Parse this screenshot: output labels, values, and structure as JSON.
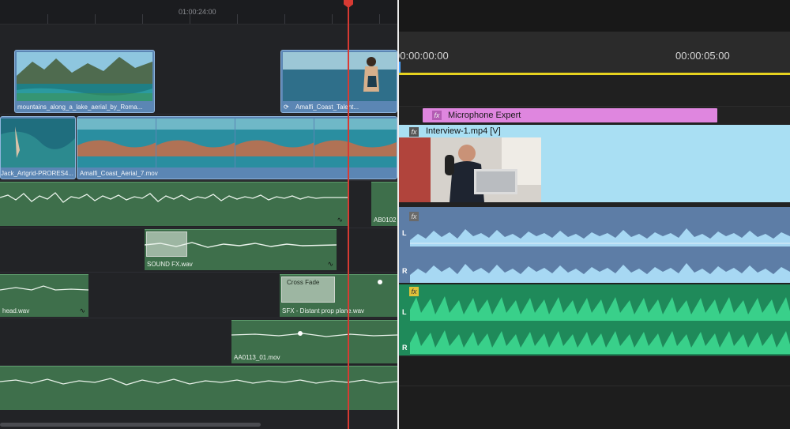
{
  "left_timeline": {
    "ruler_timecode": "01:00:24:00",
    "video_clips": [
      {
        "label": "mountains_along_a_lake_aerial_by_Roma..."
      },
      {
        "label": "Amalfi_Coast_Talent..."
      },
      {
        "label": "Jack_Artgrid-PRORES4..."
      },
      {
        "label": "Amalfi_Coast_Aerial_7.mov"
      }
    ],
    "audio_clips": [
      {
        "label": ""
      },
      {
        "label": "AB0102"
      },
      {
        "label": "SOUND FX.wav"
      },
      {
        "label": "head.wav"
      },
      {
        "label": "SFX - Distant prop plane.wav"
      },
      {
        "label": "AA0113_01.mov"
      },
      {
        "label": ""
      }
    ],
    "cross_fade_label": "Cross Fade"
  },
  "right_timeline": {
    "timecodes": [
      "00:00:00:00",
      "00:00:05:00"
    ],
    "effect_clip_label": "Microphone Expert",
    "video_clip_label": "Interview-1.mp4 [V]",
    "fx_badge": "fx",
    "channel_labels": [
      "L",
      "R",
      "L",
      "R"
    ]
  },
  "colors": {
    "playhead": "#d73a33",
    "video_clip": "#5b86b4",
    "audio_clip_left": "#3e6f4b",
    "effect_clip": "#df86df",
    "interview_clip": "#a9dff3",
    "audio_track_blue": "#5d7da6",
    "audio_track_green": "#1f8a5a",
    "work_area_bar": "#e6d21f"
  }
}
